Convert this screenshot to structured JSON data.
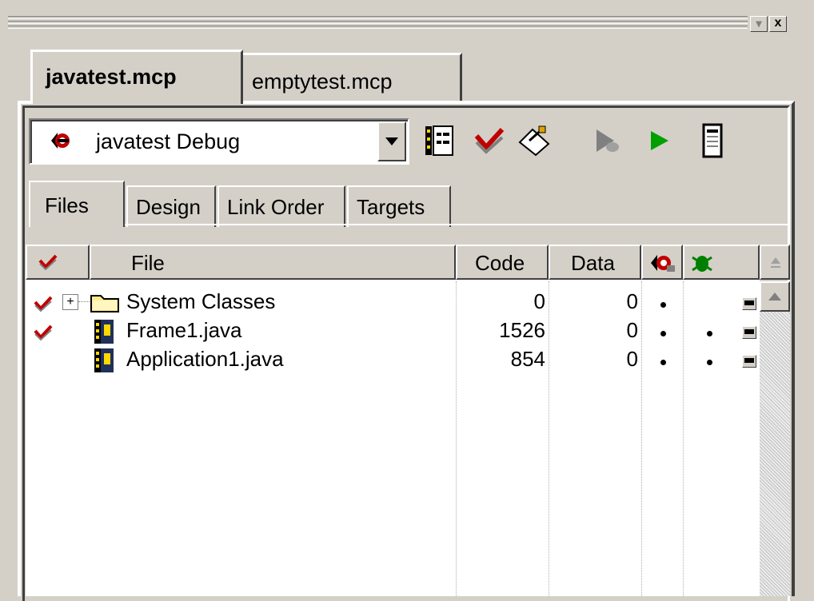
{
  "window": {
    "minimize_glyph": "▾",
    "close_glyph": "x"
  },
  "doc_tabs": [
    {
      "label": "javatest.mcp",
      "active": true
    },
    {
      "label": "emptytest.mcp",
      "active": false
    }
  ],
  "target": {
    "selected": "javatest Debug",
    "icon": "debug-target-icon"
  },
  "toolbar": [
    {
      "name": "target-settings-icon"
    },
    {
      "name": "synchronize-modification-dates-icon"
    },
    {
      "name": "make-icon"
    },
    {
      "name": "debug-icon"
    },
    {
      "name": "run-icon"
    },
    {
      "name": "project-inspector-icon"
    }
  ],
  "view_tabs": [
    {
      "label": "Files",
      "active": true
    },
    {
      "label": "Design",
      "active": false
    },
    {
      "label": "Link Order",
      "active": false
    },
    {
      "label": "Targets",
      "active": false
    }
  ],
  "columns": {
    "touch_icon": "checkmark-icon",
    "file": "File",
    "code": "Code",
    "data": "Data",
    "debug_icon": "debug-icon",
    "target_icon": "bug-icon"
  },
  "rows": [
    {
      "touched": true,
      "expandable": true,
      "expander": "+",
      "icon": "folder-icon",
      "name": "System Classes",
      "code": "0",
      "data": "0",
      "debug": true,
      "in_target": false
    },
    {
      "touched": true,
      "expandable": false,
      "icon": "java-file-icon",
      "name": "Frame1.java",
      "code": "1526",
      "data": "0",
      "debug": true,
      "in_target": true
    },
    {
      "touched": false,
      "expandable": false,
      "icon": "java-file-icon",
      "name": "Application1.java",
      "code": "854",
      "data": "0",
      "debug": true,
      "in_target": true
    }
  ],
  "colors": {
    "face": "#d4d0c8",
    "shadow": "#808080",
    "dark_shadow": "#404040",
    "highlight": "#ffffff",
    "check_red": "#c00000",
    "run_green": "#00a000"
  }
}
